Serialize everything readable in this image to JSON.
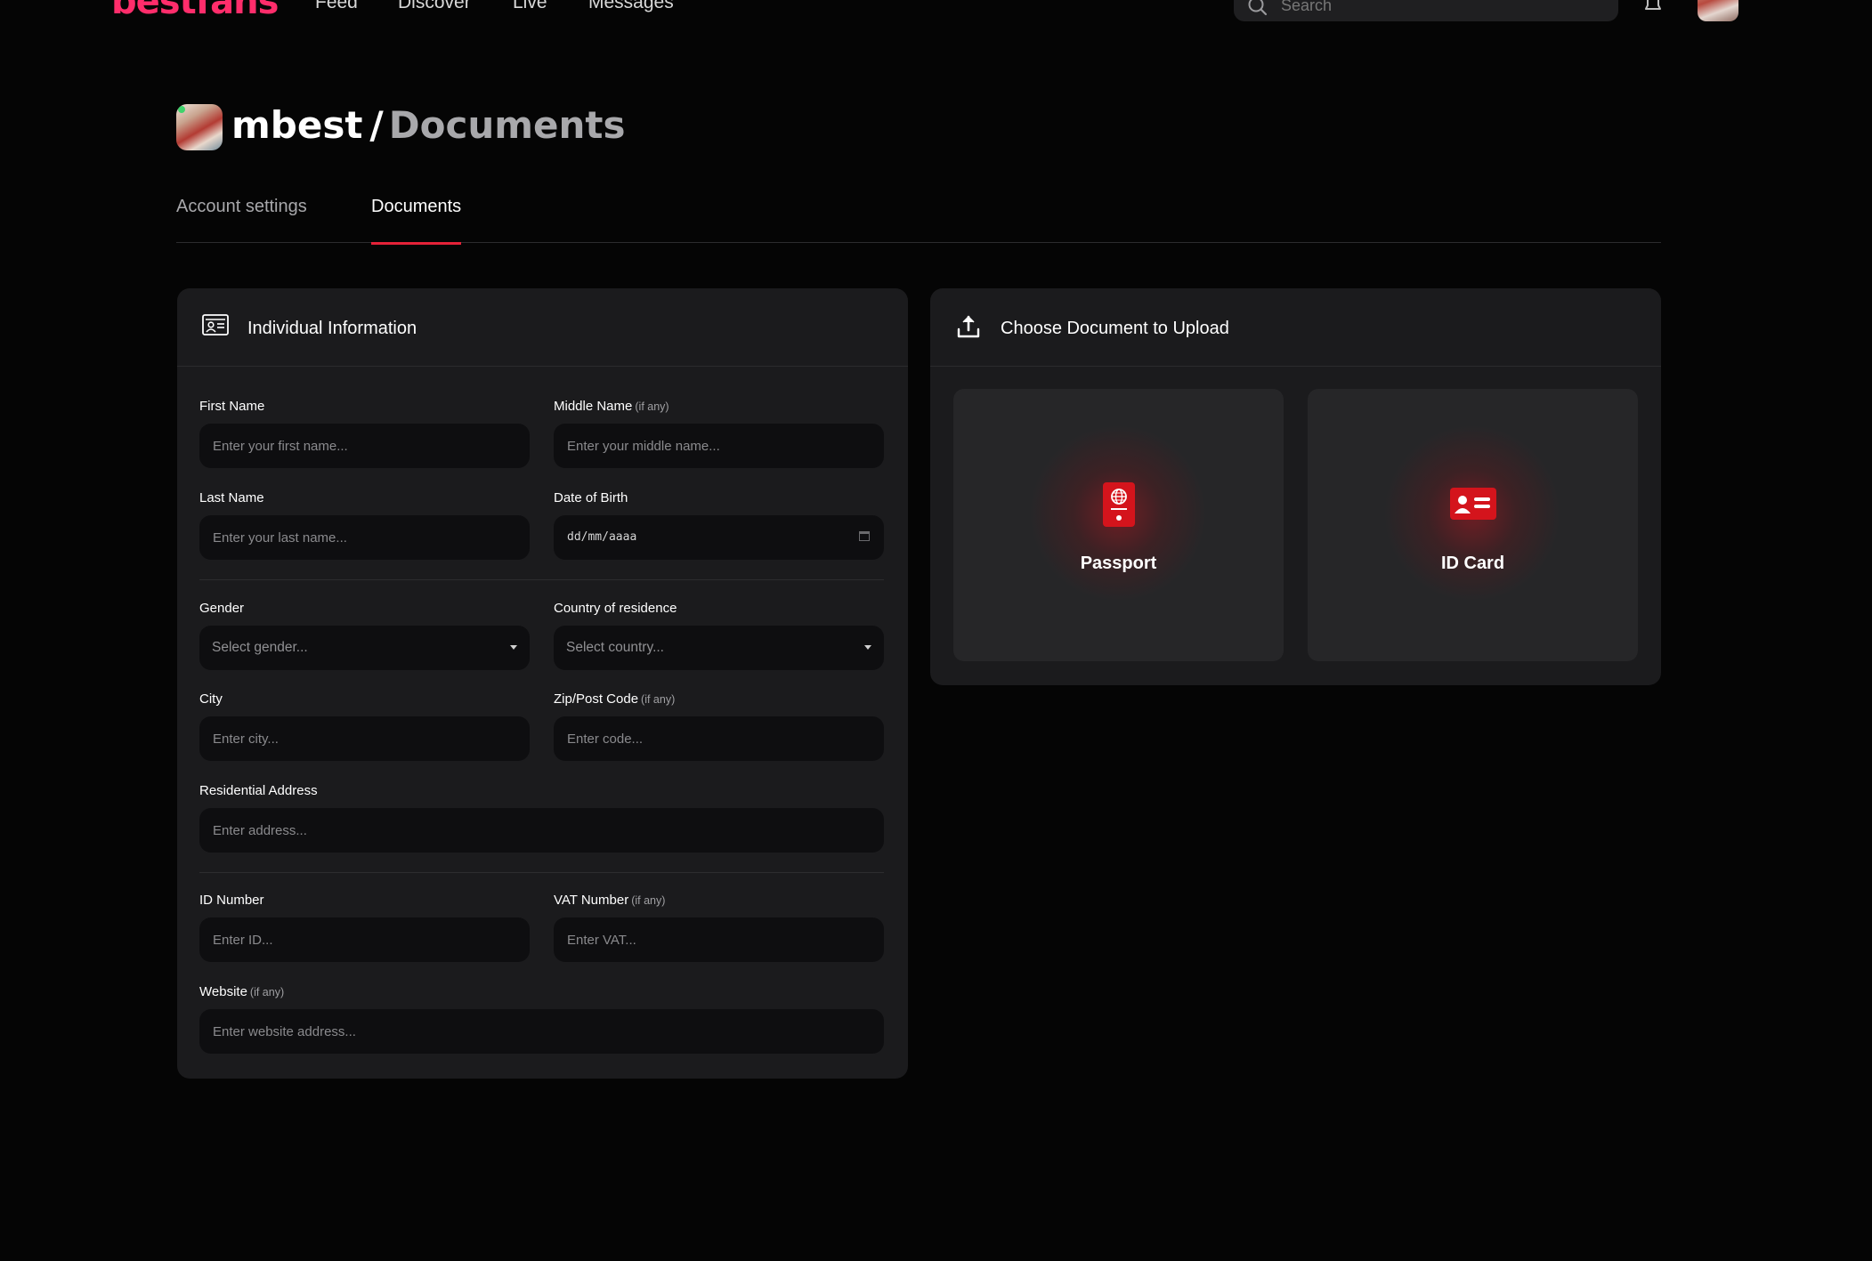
{
  "nav": {
    "logo": "bestfans",
    "links": [
      "Feed",
      "Discover",
      "Live",
      "Messages"
    ],
    "search_placeholder": "Search"
  },
  "header": {
    "username": "mbest",
    "separator": "/",
    "section": "Documents"
  },
  "tabs": [
    {
      "label": "Account settings",
      "active": false
    },
    {
      "label": "Documents",
      "active": true
    }
  ],
  "individual_info": {
    "title": "Individual Information",
    "first_name": {
      "label": "First Name",
      "placeholder": "Enter your first name..."
    },
    "middle_name": {
      "label": "Middle Name",
      "optional": "(if any)",
      "placeholder": "Enter your middle name..."
    },
    "last_name": {
      "label": "Last Name",
      "placeholder": "Enter your last name..."
    },
    "dob": {
      "label": "Date of Birth",
      "value": "dd/mm/aaaa"
    },
    "gender": {
      "label": "Gender",
      "selected": "Select gender..."
    },
    "country": {
      "label": "Country of residence",
      "selected": "Select country..."
    },
    "city": {
      "label": "City",
      "placeholder": "Enter city..."
    },
    "zip": {
      "label": "Zip/Post Code",
      "optional": "(if any)",
      "placeholder": "Enter code..."
    },
    "address": {
      "label": "Residential Address",
      "placeholder": "Enter address..."
    },
    "id_number": {
      "label": "ID Number",
      "placeholder": "Enter ID..."
    },
    "vat": {
      "label": "VAT Number",
      "optional": "(if any)",
      "placeholder": "Enter VAT..."
    },
    "website": {
      "label": "Website",
      "optional": "(if any)",
      "placeholder": "Enter website address..."
    }
  },
  "upload": {
    "title": "Choose Document to Upload",
    "options": [
      {
        "label": "Passport",
        "icon": "passport-icon"
      },
      {
        "label": "ID Card",
        "icon": "id-card-icon"
      }
    ]
  },
  "colors": {
    "background": "#050505",
    "card": "#1b1b1d",
    "field": "#0e0e10",
    "accent": "#e52238",
    "logo": "#ff2d6b",
    "icon_red": "#d4141c"
  }
}
